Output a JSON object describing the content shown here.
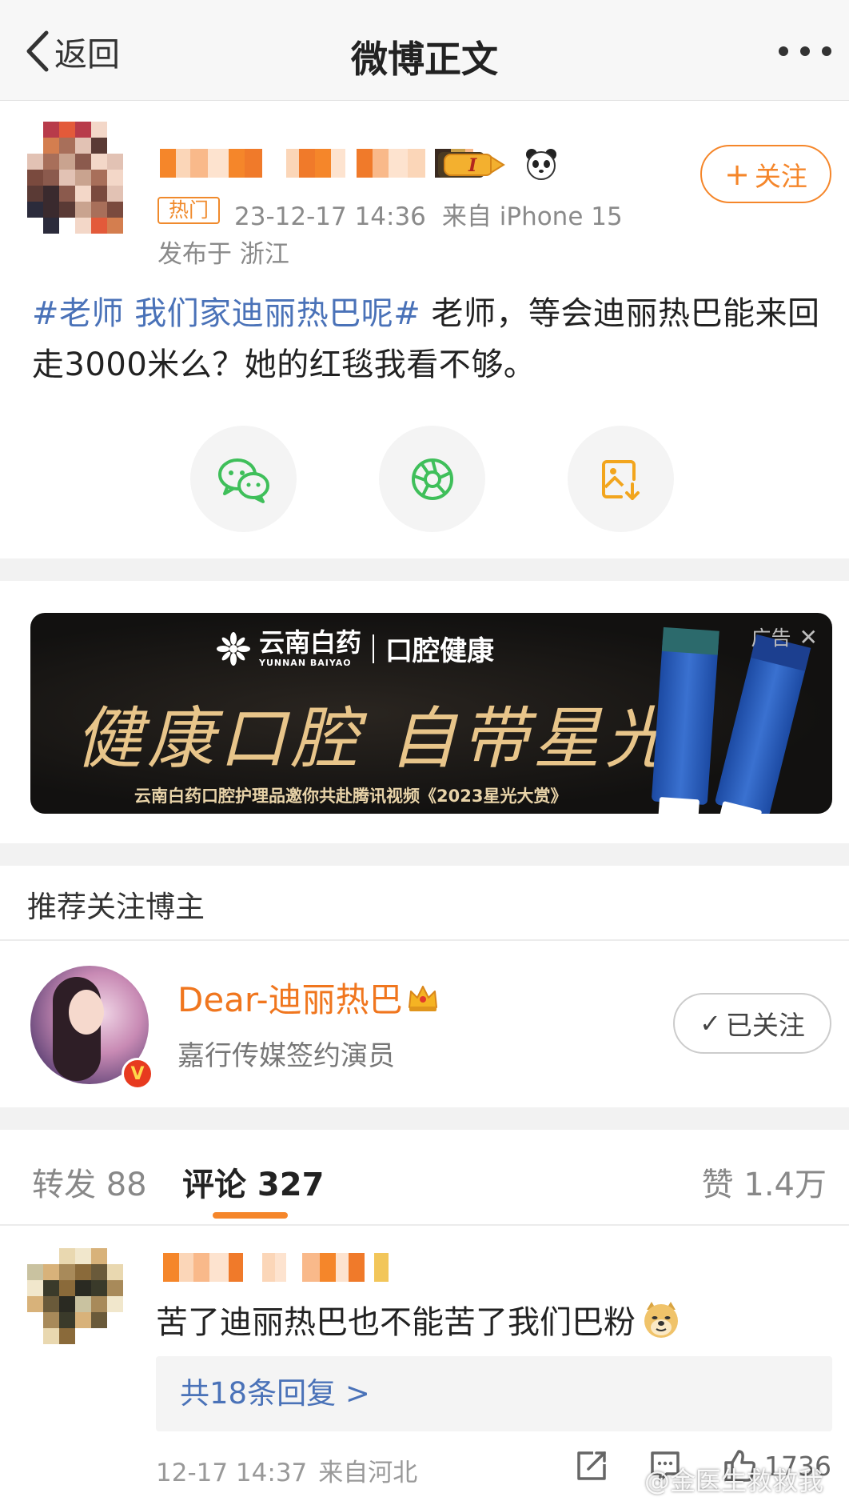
{
  "nav": {
    "back_label": "返回",
    "title": "微博正文"
  },
  "post": {
    "hot_tag": "热门",
    "time": "23-12-17 14:36",
    "source": "来自 iPhone 15",
    "location": "发布于 浙江",
    "follow_label": "关注",
    "hashtag": "#老师 我们家迪丽热巴呢#",
    "text": " 老师，等会迪丽热巴能来回走3000米么？她的红毯我看不够。",
    "level_badge_icon": "level-badge-icon",
    "panda_icon": "panda-icon"
  },
  "share": [
    {
      "name": "wechat",
      "icon": "wechat-icon"
    },
    {
      "name": "moments",
      "icon": "moments-icon"
    },
    {
      "name": "save-image",
      "icon": "save-image-icon"
    }
  ],
  "ad": {
    "brand_cn": "云南白药",
    "brand_en": "YUNNAN BAIYAO",
    "brand_line": "口腔健康",
    "slogan": "健康口腔 自带星光",
    "subtitle": "云南白药口腔护理品邀你共赴腾讯视频《2023星光大赏》",
    "ad_label": "广告",
    "close_glyph": "✕"
  },
  "recommend": {
    "title": "推荐关注博主",
    "name": "Dear-迪丽热巴",
    "description": "嘉行传媒签约演员",
    "followed_label": "已关注",
    "verified_glyph": "V"
  },
  "tabs": {
    "repost": "转发 88",
    "comment": "评论 327",
    "like": "赞 1.4万"
  },
  "comment": {
    "text": "苦了迪丽热巴也不能苦了我们巴粉",
    "replies": "共18条回复 >",
    "time": "12-17 14:37",
    "location": "来自河北",
    "like_count": "1736"
  },
  "watermark": "@金医生救救我",
  "colors": {
    "accent_orange": "#f5862a",
    "link_blue": "#4a72b8",
    "hot_orange": "#f08a2c"
  }
}
